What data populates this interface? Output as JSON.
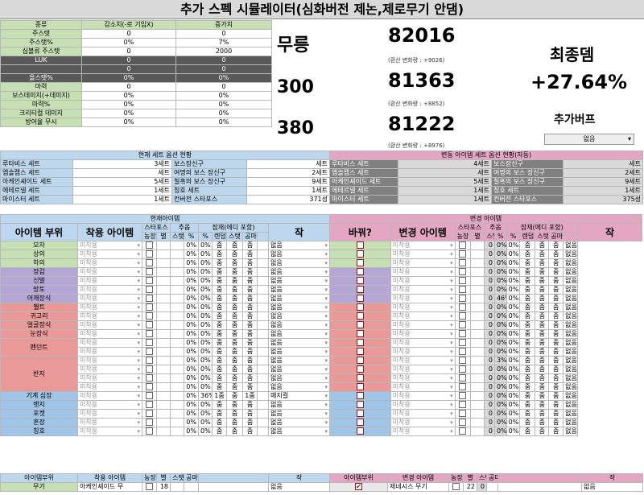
{
  "title": "추가 스펙 시뮬레이터(심화버전 제논,제로무기 안댐)",
  "stat_table": {
    "headers": [
      "종류",
      "감소치(-로 기입X)",
      "증가치"
    ],
    "rows": [
      {
        "label": "주스탯",
        "dec": "0",
        "inc": "0",
        "style": "g"
      },
      {
        "label": "주스탯%",
        "dec": "0%",
        "inc": "7%",
        "style": "g"
      },
      {
        "label": "심볼류 주스탯",
        "dec": "0",
        "inc": "2000",
        "style": "g"
      },
      {
        "label": "LUK",
        "dec": "0",
        "inc": "0",
        "style": "dk"
      },
      {
        "label": "",
        "dec": "0",
        "inc": "0",
        "style": "dk"
      },
      {
        "label": "올스탯%",
        "dec": "0%",
        "inc": "0%",
        "style": "dk"
      },
      {
        "label": "마력",
        "dec": "0",
        "inc": "0",
        "style": "g"
      },
      {
        "label": "보스데미지(+데미지)",
        "dec": "0%",
        "inc": "0%",
        "style": "g"
      },
      {
        "label": "마력%",
        "dec": "0%",
        "inc": "0%",
        "style": "g"
      },
      {
        "label": "크리티컬 데미지",
        "dec": "0%",
        "inc": "0%",
        "style": "g"
      },
      {
        "label": "방어율 무시",
        "dec": "0%",
        "inc": "0%",
        "style": "g"
      }
    ]
  },
  "results": {
    "rows": [
      {
        "label": "무릉",
        "value": "82016",
        "change": "(환산 변화량 : +9026)"
      },
      {
        "label": "300",
        "value": "81363",
        "change": "(환산 변화량 : +8852)"
      },
      {
        "label": "380",
        "value": "81222",
        "change": "(환산 변화량 : +8976)"
      }
    ],
    "final_label": "최종뎀",
    "final_value": "+27.64%",
    "buff_label": "추가버프",
    "buff_value": "없음"
  },
  "set_current": {
    "header": "현재 세트 옵션 현황",
    "rows": [
      [
        "루타비스 세트",
        "3세트",
        "보스장신구",
        "세트"
      ],
      [
        "앱솔랩스 세트",
        "세트",
        "여명의 보스 장신구",
        "2세트"
      ],
      [
        "아케인셰이드 세트",
        "5세트",
        "칠흑의 보스 장신구",
        "9세트"
      ],
      [
        "에테르넬 세트",
        "1세트",
        "칭호 세트",
        "1세트"
      ],
      [
        "마이스터 세트",
        "1세트",
        "컨버전 스타포스",
        "371성"
      ]
    ]
  },
  "set_changed": {
    "header": "변동 아이템 세트 옵션 현황(자동)",
    "rows": [
      [
        "루타비스 세트",
        "4세트",
        "보스장신구",
        "세트"
      ],
      [
        "앱솔랩스 세트",
        "세트",
        "여명의 보스 장신구",
        "2세트"
      ],
      [
        "아케인셰이드 세트",
        "5세트",
        "칠흑의 보스 장신구",
        "9세트"
      ],
      [
        "에테르넬 세트",
        "1세트",
        "칭호 세트",
        "1세트"
      ],
      [
        "마이스터 세트",
        "1세트",
        "컨버전 스타포스",
        "375성"
      ]
    ]
  },
  "cur_header": "현재아이템",
  "chg_header": "변경 아이템",
  "col_headers": {
    "part": "아이템 부위",
    "equip": "착용 아이템",
    "starforce": "스타포스",
    "nongjang": "농장",
    "byeol": "별",
    "chuop": "추옵",
    "stat": "스탯",
    "pct": "%",
    "jamjae": "잠재(에디 포함)",
    "pct2": "%",
    "rendom": "렌덤",
    "stat2": "스탯",
    "gongma": "공마",
    "jak": "작",
    "swap": "바꿔?",
    "chg_equip": "변경 아이템"
  },
  "default_item": "미착용",
  "pot_a": "줌",
  "pot_none": "없음",
  "parts": [
    {
      "name": "모자",
      "color": "g",
      "cur": {
        "pct1": "0%",
        "pct2": "0%",
        "jak": "없음"
      },
      "chg": {
        "s": "0",
        "pct1": "0%",
        "pct2": "0%",
        "jak": "없음"
      }
    },
    {
      "name": "상의",
      "color": "g",
      "cur": {
        "pct1": "0%",
        "pct2": "0%",
        "jak": "없음"
      },
      "chg": {
        "s": "0",
        "pct1": "0%",
        "pct2": "0%",
        "jak": "없음"
      }
    },
    {
      "name": "하의",
      "color": "g",
      "cur": {
        "pct1": "0%",
        "pct2": "0%",
        "jak": "없음"
      },
      "chg": {
        "s": "0",
        "pct1": "0%",
        "pct2": "0%",
        "jak": "없음"
      }
    },
    {
      "name": "장갑",
      "color": "pur",
      "cur": {
        "pct1": "0%",
        "pct2": "0%",
        "jak": "없음"
      },
      "chg": {
        "s": "0",
        "pct1": "0%",
        "pct2": "0%",
        "jak": "없음"
      }
    },
    {
      "name": "신발",
      "color": "pur",
      "cur": {
        "pct1": "0%",
        "pct2": "0%",
        "jak": "없음"
      },
      "chg": {
        "s": "0",
        "pct1": "0%",
        "pct2": "0%",
        "jak": "없음"
      }
    },
    {
      "name": "망토",
      "color": "pur",
      "cur": {
        "pct1": "0%",
        "pct2": "0%",
        "jak": "없음"
      },
      "chg": {
        "s": "0",
        "pct1": "0%",
        "pct2": "0%",
        "jak": "없음"
      }
    },
    {
      "name": "어깨장식",
      "color": "pur",
      "cur": {
        "pct1": "0%",
        "pct2": "0%",
        "jak": "없음"
      },
      "chg": {
        "s": "0",
        "pct1": "46%",
        "pct2": "0%",
        "jak": "없음"
      }
    },
    {
      "name": "벨트",
      "color": "red",
      "cur": {
        "pct1": "0%",
        "pct2": "0%",
        "jak": "없음"
      },
      "chg": {
        "s": "0",
        "pct1": "0%",
        "pct2": "0%",
        "jak": "없음"
      }
    },
    {
      "name": "귀고리",
      "color": "red",
      "cur": {
        "pct1": "0%",
        "pct2": "0%",
        "jak": "없음"
      },
      "chg": {
        "s": "0",
        "pct1": "0%",
        "pct2": "0%",
        "jak": "없음"
      }
    },
    {
      "name": "얼굴장식",
      "color": "red",
      "cur": {
        "pct1": "0%",
        "pct2": "0%",
        "jak": "없음"
      },
      "chg": {
        "s": "0",
        "pct1": "0%",
        "pct2": "0%",
        "jak": "없음"
      }
    },
    {
      "name": "눈장식",
      "color": "red",
      "cur": {
        "pct1": "0%",
        "pct2": "0%",
        "jak": "없음"
      },
      "chg": {
        "s": "0",
        "pct1": "0%",
        "pct2": "0%",
        "jak": "없음"
      }
    },
    {
      "name": "펜던트",
      "color": "red",
      "cur": {
        "pct1": "0%",
        "pct2": "0%",
        "jak": "없음"
      },
      "chg": {
        "s": "0",
        "pct1": "0%",
        "pct2": "0%",
        "jak": "없음"
      }
    },
    {
      "name": "",
      "color": "red",
      "cur": {
        "pct1": "0%",
        "pct2": "0%",
        "jak": "없음"
      },
      "chg": {
        "s": "0",
        "pct1": "0%",
        "pct2": "0%",
        "jak": "없음"
      }
    },
    {
      "name": "반지",
      "color": "red",
      "cur": {
        "pct1": "0%",
        "pct2": "0%",
        "jak": "없음"
      },
      "chg": {
        "s": "0",
        "pct1": "3%",
        "pct2": "0%",
        "jak": "없음"
      }
    },
    {
      "name": "",
      "color": "red",
      "cur": {
        "pct1": "0%",
        "pct2": "0%",
        "jak": "없음"
      },
      "chg": {
        "s": "0",
        "pct1": "0%",
        "pct2": "0%",
        "jak": "없음"
      }
    },
    {
      "name": "",
      "color": "red",
      "cur": {
        "pct1": "0%",
        "pct2": "0%",
        "jak": "없음"
      },
      "chg": {
        "s": "0",
        "pct1": "0%",
        "pct2": "0%",
        "jak": "없음"
      }
    },
    {
      "name": "",
      "color": "red",
      "cur": {
        "pct1": "0%",
        "pct2": "0%",
        "jak": "없음"
      },
      "chg": {
        "s": "0",
        "pct1": "0%",
        "pct2": "0%",
        "jak": "없음"
      }
    },
    {
      "name": "기계 심장",
      "color": "lblue",
      "cur": {
        "pct1": "0%",
        "pct2": "36%",
        "p3": "1줌",
        "p4": "1줌",
        "jak": "매지컬"
      },
      "chg": {
        "s": "0",
        "pct1": "0%",
        "pct2": "0%",
        "jak": "없음"
      }
    },
    {
      "name": "뱃지",
      "color": "lblue",
      "cur": {
        "pct1": "0%",
        "pct2": "0%",
        "jak": "없음"
      },
      "chg": {
        "s": "0",
        "pct1": "0%",
        "pct2": "0%",
        "jak": "없음"
      }
    },
    {
      "name": "포켓",
      "color": "lblue",
      "cur": {
        "pct1": "0%",
        "pct2": "0%",
        "jak": "없음"
      },
      "chg": {
        "s": "0",
        "pct1": "0%",
        "pct2": "0%",
        "jak": "없음"
      }
    },
    {
      "name": "훈장",
      "color": "lblue",
      "cur": {
        "pct1": "0%",
        "pct2": "0%",
        "jak": "없음"
      },
      "chg": {
        "s": "0",
        "pct1": "0%",
        "pct2": "0%",
        "jak": "없음"
      }
    },
    {
      "name": "칭호",
      "color": "lblue",
      "cur": {
        "pct1": "0%",
        "pct2": "0%",
        "jak": "없음"
      },
      "chg": {
        "s": "0",
        "pct1": "0%",
        "pct2": "0%",
        "jak": "없음"
      }
    }
  ],
  "weapon": {
    "hdr_part": "아이템부위",
    "hdr_equip": "착용 아이템",
    "hdr_nj": "농장",
    "hdr_byeol": "별",
    "hdr_stat": "스탯",
    "hdr_gm": "공마",
    "hdr_jak": "작",
    "part": "무기",
    "cur_item": "아케인셰이드 무",
    "cur_star": "18",
    "cur_jak": "없음",
    "chg_item": "제네시스 무기",
    "chg_star": "22",
    "chg_s": "0",
    "chg_jak": "없음"
  },
  "colors": {
    "green": "#c6e0b4",
    "blue": "#bdd7ee",
    "pink": "#e3a6c3",
    "purple": "#b4a7d6",
    "red": "#ea9999",
    "lightblue": "#9fc5e8"
  }
}
